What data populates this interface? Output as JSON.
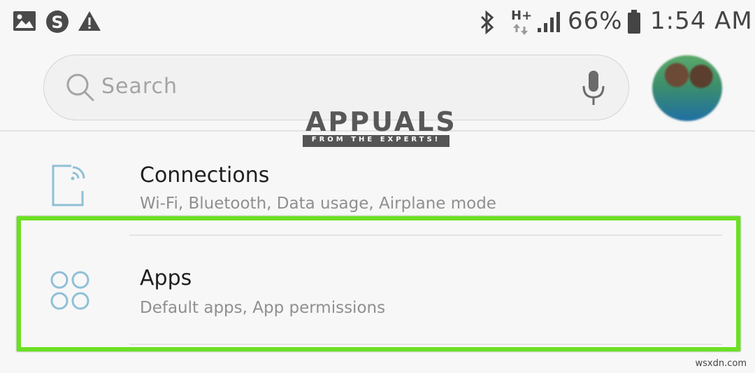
{
  "status_bar": {
    "left_icons": [
      "image-icon",
      "skype-icon",
      "warning-icon"
    ],
    "right_icons": [
      "bluetooth-icon",
      "network-hplus-icon",
      "signal-icon",
      "battery-icon"
    ],
    "network_type": "H+",
    "battery_percent": "66%",
    "time": "1:54 AM"
  },
  "search": {
    "placeholder": "Search",
    "icon": "search-icon",
    "mic_icon": "microphone-icon"
  },
  "profile": {
    "avatar_icon": "avatar"
  },
  "watermark": {
    "brand": "APPUALS",
    "tagline": "FROM THE EXPERTS!"
  },
  "settings": [
    {
      "title": "Connections",
      "subtitle": "Wi-Fi, Bluetooth, Data usage, Airplane mode",
      "icon": "connections-icon"
    },
    {
      "title": "Apps",
      "subtitle": "Default apps, App permissions",
      "icon": "apps-icon",
      "highlighted": true
    }
  ],
  "colors": {
    "highlight": "#6be022",
    "icon_blue": "#8fc0d6",
    "text_primary": "#1f1f1f",
    "text_secondary": "#8f8f8f"
  },
  "corner_watermark": "wsxdn.com"
}
